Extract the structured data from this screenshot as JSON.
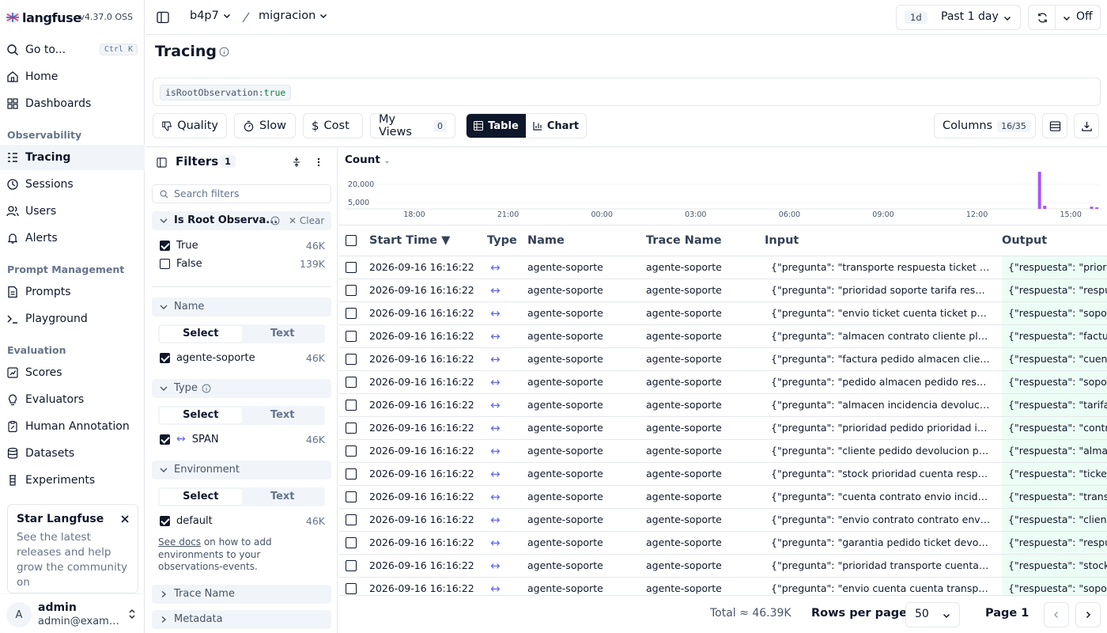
{
  "app": {
    "name": "langfuse",
    "version": "v4.37.0 OSS"
  },
  "sidebar": {
    "goto": {
      "label": "Go to...",
      "shortcut": "Ctrl K"
    },
    "home": "Home",
    "dashboards": "Dashboards",
    "sections": {
      "observability": "Observability",
      "prompt_management": "Prompt Management",
      "evaluation": "Evaluation"
    },
    "tracing": "Tracing",
    "sessions": "Sessions",
    "users": "Users",
    "alerts": "Alerts",
    "prompts": "Prompts",
    "playground": "Playground",
    "scores": "Scores",
    "evaluators": "Evaluators",
    "human_annotation": "Human Annotation",
    "datasets": "Datasets",
    "experiments": "Experiments",
    "promo": {
      "title": "Star Langfuse",
      "text": "See the latest releases and help grow the community on"
    },
    "user": {
      "initial": "A",
      "name": "admin",
      "email": "admin@example.com"
    }
  },
  "topbar": {
    "org": "b4p7",
    "project": "migracion",
    "range_badge": "1d",
    "range_label": "Past 1 day",
    "refresh_label": "Off"
  },
  "page": {
    "title": "Tracing"
  },
  "search": {
    "key": "isRootObservation",
    "sep": ":",
    "value": "true"
  },
  "toolbar": {
    "quality": "Quality",
    "slow": "Slow",
    "cost": "Cost",
    "my_views": "My Views",
    "my_views_count": "0",
    "table": "Table",
    "chart": "Chart",
    "columns": "Columns",
    "columns_count": "16/35"
  },
  "filters": {
    "title": "Filters",
    "count": "1",
    "search_placeholder": "Search filters",
    "root": {
      "label": "Is Root Observa...",
      "clear": "Clear",
      "options": [
        {
          "label": "True",
          "count": "46K",
          "checked": true
        },
        {
          "label": "False",
          "count": "139K",
          "checked": false
        }
      ]
    },
    "name": {
      "label": "Name",
      "select": "Select",
      "text": "Text",
      "option": {
        "label": "agente-soporte",
        "count": "46K"
      }
    },
    "type": {
      "label": "Type",
      "select": "Select",
      "text": "Text",
      "option": {
        "label": "SPAN",
        "count": "46K"
      }
    },
    "environment": {
      "label": "Environment",
      "select": "Select",
      "text": "Text",
      "option": {
        "label": "default",
        "count": "46K"
      }
    },
    "docs": {
      "link": "See docs",
      "text": " on how to add environments to your observations-events."
    },
    "trace_name": "Trace Name",
    "metadata": "Metadata"
  },
  "chart_data": {
    "type": "bar",
    "title": "Count",
    "y_ticks": [
      "20,000",
      "5,000"
    ],
    "x_ticks": [
      "18:00",
      "21:00",
      "00:00",
      "03:00",
      "06:00",
      "09:00",
      "12:00",
      "15:00"
    ],
    "series": [
      {
        "values": [
          {
            "t": "14:00",
            "v": 30000
          },
          {
            "t": "14:10",
            "v": 2500
          },
          {
            "t": "15:40",
            "v": 1800
          },
          {
            "t": "15:50",
            "v": 1200
          }
        ]
      }
    ],
    "ylim": [
      0,
      32000
    ],
    "bar_color": "#a855f7"
  },
  "table": {
    "columns": {
      "start_time": "Start Time ▼",
      "type": "Type",
      "name": "Name",
      "trace_name": "Trace Name",
      "input": "Input",
      "output": "Output"
    },
    "type_glyph": "↔",
    "rows": [
      {
        "time": "2026-09-16 16:16:22",
        "name": "agente-soporte",
        "trace": "agente-soporte",
        "input": "{\"pregunta\": \"transporte respuesta ticket tic...",
        "output": "{\"respuesta\": \"priorid"
      },
      {
        "time": "2026-09-16 16:16:22",
        "name": "agente-soporte",
        "trace": "agente-soporte",
        "input": "{\"pregunta\": \"prioridad soporte tarifa respue...",
        "output": "{\"respuesta\": \"respue"
      },
      {
        "time": "2026-09-16 16:16:22",
        "name": "agente-soporte",
        "trace": "agente-soporte",
        "input": "{\"pregunta\": \"envio ticket cuenta ticket prior...",
        "output": "{\"respuesta\": \"soport"
      },
      {
        "time": "2026-09-16 16:16:22",
        "name": "agente-soporte",
        "trace": "agente-soporte",
        "input": "{\"pregunta\": \"almacen contrato cliente plazo...",
        "output": "{\"respuesta\": \"factura"
      },
      {
        "time": "2026-09-16 16:16:22",
        "name": "agente-soporte",
        "trace": "agente-soporte",
        "input": "{\"pregunta\": \"factura pedido almacen cliente...",
        "output": "{\"respuesta\": \"cuenta"
      },
      {
        "time": "2026-09-16 16:16:22",
        "name": "agente-soporte",
        "trace": "agente-soporte",
        "input": "{\"pregunta\": \"pedido almacen pedido respue...",
        "output": "{\"respuesta\": \"soport"
      },
      {
        "time": "2026-09-16 16:16:22",
        "name": "agente-soporte",
        "trace": "agente-soporte",
        "input": "{\"pregunta\": \"almacen incidencia devolucion...",
        "output": "{\"respuesta\": \"tarifa a"
      },
      {
        "time": "2026-09-16 16:16:22",
        "name": "agente-soporte",
        "trace": "agente-soporte",
        "input": "{\"pregunta\": \"prioridad pedido prioridad inci...",
        "output": "{\"respuesta\": \"contra"
      },
      {
        "time": "2026-09-16 16:16:22",
        "name": "agente-soporte",
        "trace": "agente-soporte",
        "input": "{\"pregunta\": \"cliente pedido devolucion plaz...",
        "output": "{\"respuesta\": \"almac"
      },
      {
        "time": "2026-09-16 16:16:22",
        "name": "agente-soporte",
        "trace": "agente-soporte",
        "input": "{\"pregunta\": \"stock prioridad cuenta respues...",
        "output": "{\"respuesta\": \"ticket"
      },
      {
        "time": "2026-09-16 16:16:22",
        "name": "agente-soporte",
        "trace": "agente-soporte",
        "input": "{\"pregunta\": \"cuenta contrato envio incidenc...",
        "output": "{\"respuesta\": \"transp"
      },
      {
        "time": "2026-09-16 16:16:22",
        "name": "agente-soporte",
        "trace": "agente-soporte",
        "input": "{\"pregunta\": \"envio contrato contrato envio ...",
        "output": "{\"respuesta\": \"cliente"
      },
      {
        "time": "2026-09-16 16:16:22",
        "name": "agente-soporte",
        "trace": "agente-soporte",
        "input": "{\"pregunta\": \"garantia pedido ticket devoluci...",
        "output": "{\"respuesta\": \"respue"
      },
      {
        "time": "2026-09-16 16:16:22",
        "name": "agente-soporte",
        "trace": "agente-soporte",
        "input": "{\"pregunta\": \"prioridad transporte cuenta ac...",
        "output": "{\"respuesta\": \"stock f"
      },
      {
        "time": "2026-09-16 16:16:22",
        "name": "agente-soporte",
        "trace": "agente-soporte",
        "input": "{\"pregunta\": \"envio cuenta cuenta transport...",
        "output": "{\"respuesta\": \"soport"
      }
    ]
  },
  "footer": {
    "total": "Total ≈ 46.39K",
    "rows_per_page_label": "Rows per page",
    "rows_per_page": "50",
    "page": "Page 1"
  }
}
